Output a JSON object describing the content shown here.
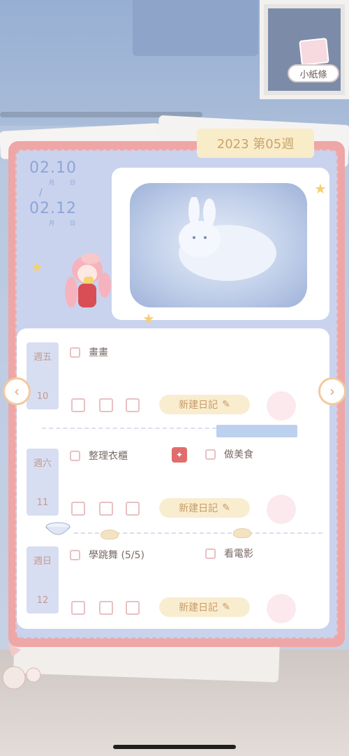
{
  "top_right": {
    "note_button_label": "小紙條"
  },
  "week_tab": {
    "label": "2023 第05週"
  },
  "date_range": {
    "start": "02.10",
    "end": "02.12",
    "month_label": "月",
    "day_label": "日"
  },
  "days": [
    {
      "weekday": "週五",
      "day": "10",
      "tasks": [
        {
          "label": "畫畫"
        }
      ],
      "diary_button": "新建日記"
    },
    {
      "weekday": "週六",
      "day": "11",
      "tasks": [
        {
          "label": "整理衣櫃"
        },
        {
          "label": "做美食"
        }
      ],
      "diary_button": "新建日記"
    },
    {
      "weekday": "週日",
      "day": "12",
      "tasks": [
        {
          "label": "學跳舞 (5/5)"
        },
        {
          "label": "看電影"
        }
      ],
      "diary_button": "新建日記"
    }
  ],
  "icons": {
    "prev": "chevron-left-icon",
    "next": "chevron-right-icon",
    "edit": "edit-icon",
    "gift": "gift-icon",
    "star": "star-icon"
  },
  "colors": {
    "book_border": "#efa6a6",
    "inner_bg": "#c9d3ee",
    "accent_gold": "#c89a67",
    "date_blue": "#8fa4d6"
  }
}
